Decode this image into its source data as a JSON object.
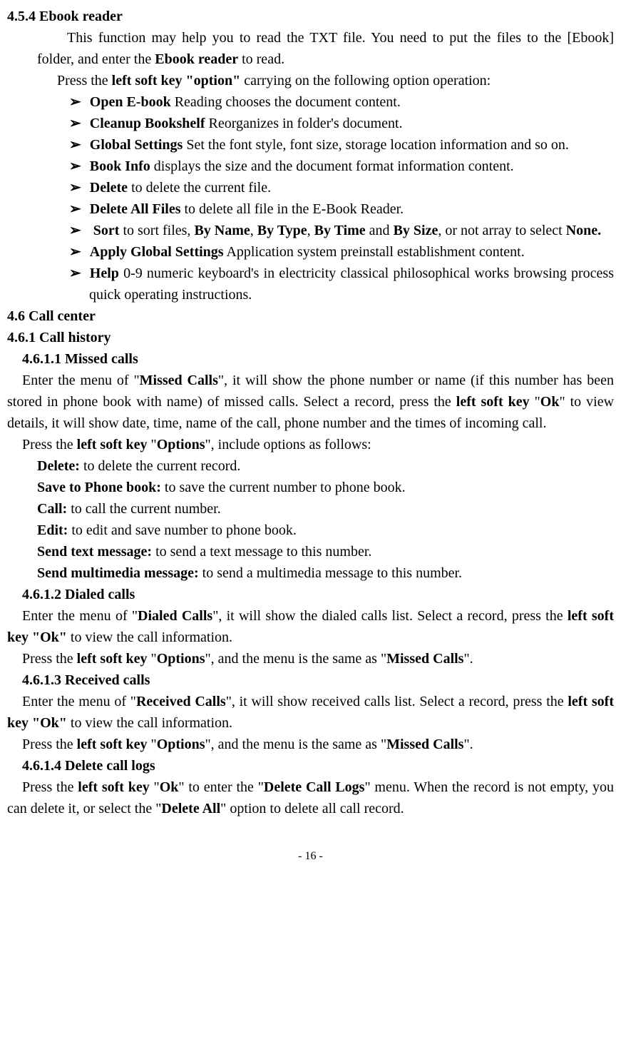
{
  "sec454": {
    "title": "4.5.4 Ebook reader",
    "intro": "This function may help you to read the TXT file. You need to put the files to the [Ebook] folder, and enter the ",
    "intro_bold": "Ebook reader",
    "intro_tail": " to read.",
    "press": "Press the ",
    "press_bold": "left soft key \"option\"",
    "press_tail": " carrying on the following option operation:",
    "bullets": [
      {
        "t": "Open E-book",
        "d": " Reading chooses the document content."
      },
      {
        "t": "Cleanup Bookshelf",
        "d": " Reorganizes in folder's document."
      },
      {
        "t": "Global Settings",
        "d": "   Set the font style, font size, storage location information and so on."
      },
      {
        "t": "Book Info",
        "d": "   displays the size and the document format information content."
      },
      {
        "t": "Delete",
        "d": "   to delete the current file."
      },
      {
        "t": "Delete All Files",
        "d": "    to delete all file in the E-Book Reader."
      },
      {
        "t": "Sort",
        "sort_mid": "     to sort files, ",
        "s1": "By Name",
        "c1": ", ",
        "s2": "By Type",
        "c2": ", ",
        "s3": "By Time",
        "c3": " and ",
        "s4": "By Size",
        "tail1": ", or not array to select ",
        "none": "None."
      },
      {
        "t": "Apply Global Settings",
        "d": "  Application system preinstall establishment content."
      },
      {
        "t": "Help",
        "d": "   0-9 numeric keyboard's in electricity classical philosophical works browsing process quick operating instructions."
      }
    ]
  },
  "sec46": {
    "title": "4.6 Call center"
  },
  "sec461": {
    "title": "4.6.1 Call history"
  },
  "sec4611": {
    "title": "4.6.1.1 Missed calls",
    "p1a": "Enter the menu of \"",
    "p1b": "Missed Calls",
    "p1c": "\", it will show the phone number or name (if this number has been stored in phone book with name) of missed calls. Select a record, press the ",
    "p1d": "left soft key",
    "p1e": " \"",
    "p1f": "Ok",
    "p1g": "\" to view details, it will show date, time, name of the call, phone number and the times of incoming call.",
    "p2a": "Press the ",
    "p2b": "left soft key",
    "p2c": " \"",
    "p2d": "Options",
    "p2e": "\", include options as follows:",
    "opts": [
      {
        "t": "Delete:",
        "d": "    to delete the current record."
      },
      {
        "t": "Save to Phone book:",
        "d": " to save the current number to phone book."
      },
      {
        "t": "Call:",
        "d": "       to call the current number."
      },
      {
        "t": "Edit:",
        "d": "  to edit and save number to phone book."
      },
      {
        "t": "Send text message:",
        "d": "   to send a text message to this number."
      },
      {
        "t": "Send multimedia message:",
        "d": " to send a multimedia message to this number."
      }
    ]
  },
  "sec4612": {
    "title": "4.6.1.2 Dialed calls",
    "p1a": "Enter the menu of \"",
    "p1b": "Dialed Calls",
    "p1c": "\", it will show the dialed calls list. Select a record, press the ",
    "p1d": "left soft key \"Ok\"",
    "p1e": " to view the call information.",
    "p2a": "Press the ",
    "p2b": "left soft key",
    "p2c": " \"",
    "p2d": "Options",
    "p2e": "\", and the menu is the same as \"",
    "p2f": "Missed Calls",
    "p2g": "\"."
  },
  "sec4613": {
    "title": "4.6.1.3 Received calls",
    "p1a": "Enter the menu of \"",
    "p1b": "Received Calls",
    "p1c": "\", it will show received calls list. Select a record, press the ",
    "p1d": "left soft key \"Ok\"",
    "p1e": " to view the call information.",
    "p2a": "Press the ",
    "p2b": "left soft key",
    "p2c": " \"",
    "p2d": "Options",
    "p2e": "\", and the menu is the same as \"",
    "p2f": "Missed Calls",
    "p2g": "\"."
  },
  "sec4614": {
    "title": "4.6.1.4 Delete call logs",
    "p1a": "Press the ",
    "p1b": "left soft key",
    "p1c": " \"",
    "p1d": "Ok",
    "p1e": "\" to enter the \"",
    "p1f": "Delete Call Logs",
    "p1g": "\" menu. When the record is not empty, you can delete it, or select the \"",
    "p1h": "Delete All",
    "p1i": "\" option to delete all call record."
  },
  "page": "- 16 -"
}
